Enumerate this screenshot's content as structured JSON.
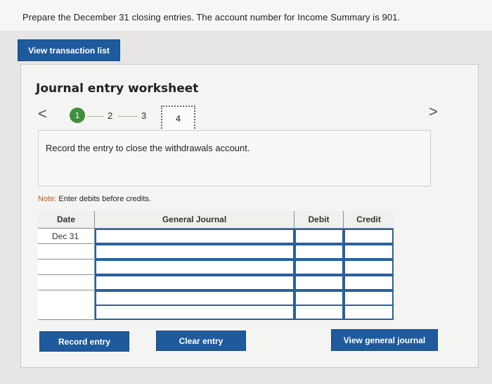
{
  "prompt": "Prepare the December 31 closing entries. The account number for Income Summary is 901.",
  "buttons": {
    "view_transaction_list": "View transaction list",
    "record_entry": "Record entry",
    "clear_entry": "Clear entry",
    "view_general_journal": "View general journal"
  },
  "worksheet": {
    "title": "Journal entry worksheet",
    "nav_prev": "<",
    "nav_next": ">",
    "steps": [
      "1",
      "2",
      "3",
      "4"
    ],
    "active_step": "1",
    "current_step": "4",
    "instruction": "Record the entry to close the withdrawals account.",
    "note_label": "Note:",
    "note_text": "Enter debits before credits."
  },
  "journal": {
    "columns": [
      "Date",
      "General Journal",
      "Debit",
      "Credit"
    ],
    "rows": [
      {
        "date": "Dec 31",
        "account": "",
        "debit": "",
        "credit": ""
      },
      {
        "date": "",
        "account": "",
        "debit": "",
        "credit": ""
      },
      {
        "date": "",
        "account": "",
        "debit": "",
        "credit": ""
      },
      {
        "date": "",
        "account": "",
        "debit": "",
        "credit": ""
      },
      {
        "date": "",
        "account": "",
        "debit": "",
        "credit": ""
      },
      {
        "date": "",
        "account": "",
        "debit": "",
        "credit": ""
      }
    ]
  },
  "colors": {
    "button": "#1f5b9c",
    "active_step": "#3f8f3c",
    "input_border": "#2a5f9e",
    "note_label": "#b85a17"
  }
}
